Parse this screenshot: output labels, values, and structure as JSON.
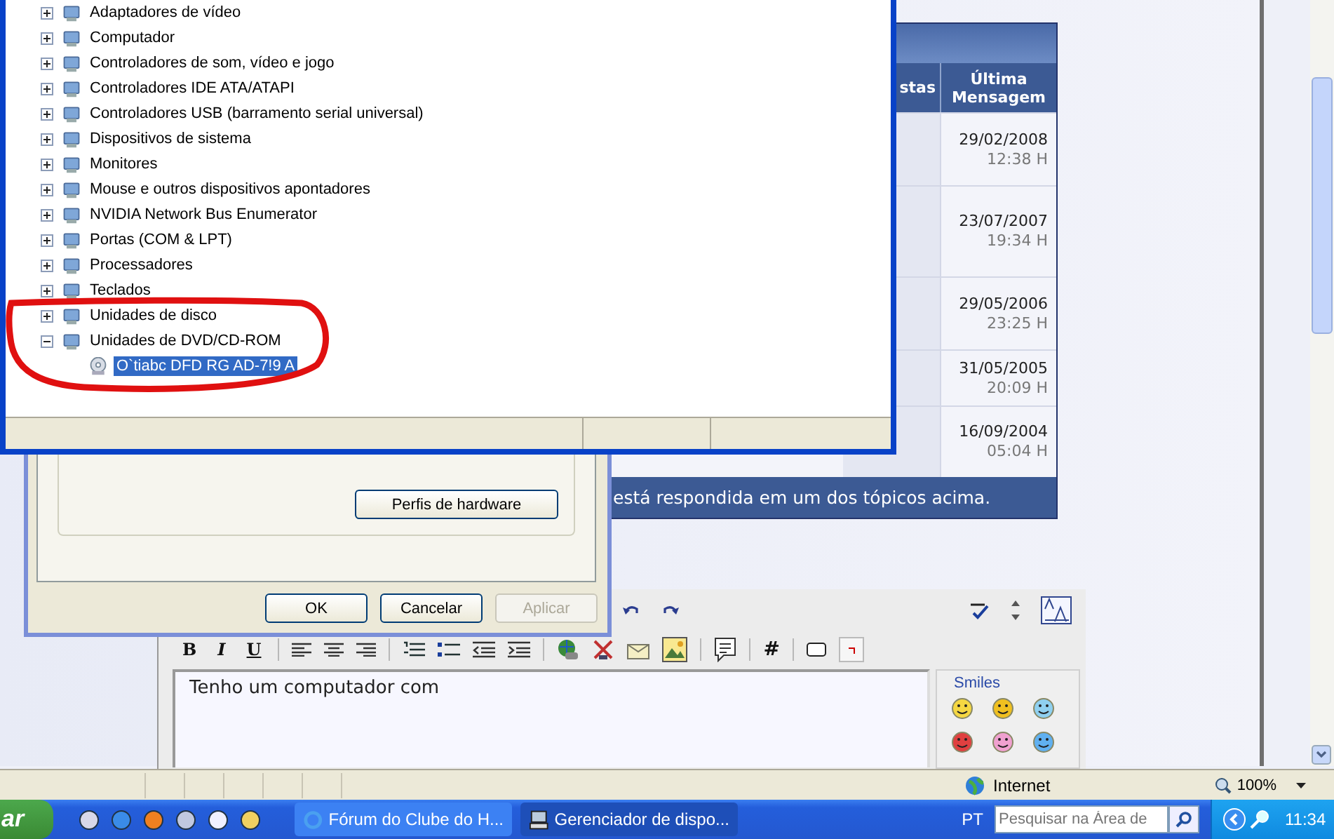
{
  "device_manager": {
    "tree": [
      {
        "label": "Adaptadores de vídeo",
        "expanded": false
      },
      {
        "label": "Computador",
        "expanded": false
      },
      {
        "label": "Controladores de som, vídeo e jogo",
        "expanded": false
      },
      {
        "label": "Controladores IDE ATA/ATAPI",
        "expanded": false
      },
      {
        "label": "Controladores USB (barramento serial universal)",
        "expanded": false
      },
      {
        "label": "Dispositivos de sistema",
        "expanded": false
      },
      {
        "label": "Monitores",
        "expanded": false
      },
      {
        "label": "Mouse e outros dispositivos apontadores",
        "expanded": false
      },
      {
        "label": "NVIDIA Network Bus Enumerator",
        "expanded": false
      },
      {
        "label": "Portas (COM & LPT)",
        "expanded": false
      },
      {
        "label": "Processadores",
        "expanded": false
      },
      {
        "label": "Teclados",
        "expanded": false
      },
      {
        "label": "Unidades de disco",
        "expanded": false
      },
      {
        "label": "Unidades de DVD/CD-ROM",
        "expanded": true,
        "children": [
          {
            "label": "O`tiabc DFD RG AD-7!9 A",
            "selected": true
          }
        ]
      }
    ]
  },
  "properties_dialog": {
    "group_button": "Perfis de hardware",
    "buttons": [
      {
        "label": "OK",
        "disabled": false
      },
      {
        "label": "Cancelar",
        "disabled": false
      },
      {
        "label": "Aplicar",
        "disabled": true
      }
    ]
  },
  "forum_table": {
    "columns": [
      "stas",
      "Última Mensagem"
    ],
    "rows": [
      {
        "date": "29/02/2008",
        "time": "12:38 H"
      },
      {
        "date": "23/07/2007",
        "time": "19:34 H"
      },
      {
        "date": "29/05/2006",
        "time": "23:25 H"
      },
      {
        "date": "31/05/2005",
        "time": "20:09 H"
      },
      {
        "date": "16/09/2004",
        "time": "05:04 H"
      }
    ],
    "footer": "está respondida em um dos tópicos acima."
  },
  "editor": {
    "format_buttons": [
      "B",
      "I",
      "U"
    ],
    "hash_button": "#",
    "text": "Tenho um computador com",
    "smiles_title": "Smiles"
  },
  "browser_status": {
    "zone": "Internet",
    "zoom": "100%"
  },
  "taskbar": {
    "start": "ar",
    "tasks": [
      {
        "label": "Fórum do Clube do H...",
        "selected": false
      },
      {
        "label": "Gerenciador de dispo...",
        "selected": true
      }
    ],
    "language": "PT",
    "search": {
      "placeholder": "Pesquisar na Área de"
    },
    "clock": "11:34"
  }
}
